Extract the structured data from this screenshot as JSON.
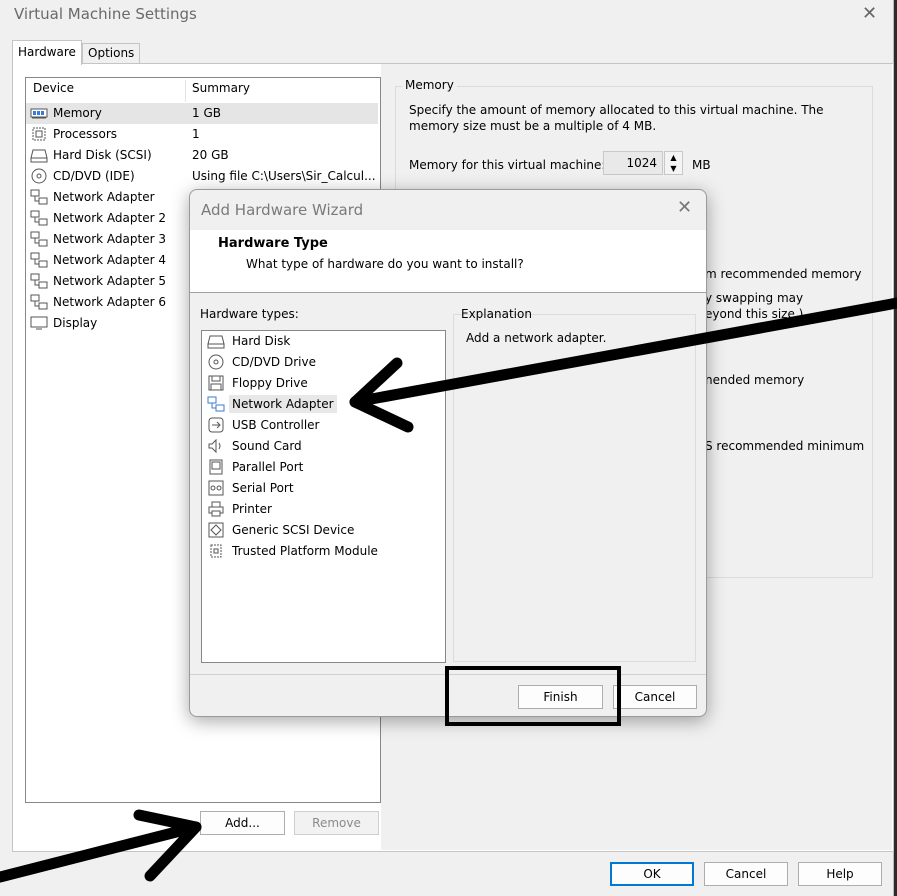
{
  "window": {
    "title": "Virtual Machine Settings",
    "close_glyph": "✕",
    "tabs": [
      "Hardware",
      "Options"
    ]
  },
  "device_list": {
    "columns": [
      "Device",
      "Summary"
    ],
    "rows": [
      {
        "icon": "memory-icon",
        "name": "Memory",
        "summary": "1 GB"
      },
      {
        "icon": "processor-icon",
        "name": "Processors",
        "summary": "1"
      },
      {
        "icon": "hard-disk-icon",
        "name": "Hard Disk (SCSI)",
        "summary": "20 GB"
      },
      {
        "icon": "cd-dvd-icon",
        "name": "CD/DVD (IDE)",
        "summary": "Using file C:\\Users\\Sir_Calcul..."
      },
      {
        "icon": "network-adapter-icon",
        "name": "Network Adapter",
        "summary": ""
      },
      {
        "icon": "network-adapter-icon",
        "name": "Network Adapter 2",
        "summary": ""
      },
      {
        "icon": "network-adapter-icon",
        "name": "Network Adapter 3",
        "summary": ""
      },
      {
        "icon": "network-adapter-icon",
        "name": "Network Adapter 4",
        "summary": ""
      },
      {
        "icon": "network-adapter-icon",
        "name": "Network Adapter 5",
        "summary": ""
      },
      {
        "icon": "network-adapter-icon",
        "name": "Network Adapter 6",
        "summary": ""
      },
      {
        "icon": "display-icon",
        "name": "Display",
        "summary": ""
      }
    ]
  },
  "memory": {
    "group_title": "Memory",
    "description": "Specify the amount of memory allocated to this virtual machine. The memory size must be a multiple of 4 MB.",
    "field_label": "Memory for this virtual machine:",
    "value": "1024",
    "unit": "MB",
    "partial_lines": [
      "m recommended memory",
      "y swapping may",
      "eyond this size.)",
      "nended memory",
      "S recommended minimum"
    ]
  },
  "buttons": {
    "add": "Add...",
    "remove": "Remove",
    "ok": "OK",
    "cancel": "Cancel",
    "help": "Help"
  },
  "wizard": {
    "title": "Add Hardware Wizard",
    "close_glyph": "✕",
    "header_title": "Hardware Type",
    "header_subtitle": "What type of hardware do you want to install?",
    "types_label": "Hardware types:",
    "types": [
      {
        "icon": "hard-disk-icon",
        "name": "Hard Disk"
      },
      {
        "icon": "cd-dvd-icon",
        "name": "CD/DVD Drive"
      },
      {
        "icon": "floppy-icon",
        "name": "Floppy Drive"
      },
      {
        "icon": "network-adapter-icon",
        "name": "Network Adapter"
      },
      {
        "icon": "usb-icon",
        "name": "USB Controller"
      },
      {
        "icon": "sound-icon",
        "name": "Sound Card"
      },
      {
        "icon": "parallel-port-icon",
        "name": "Parallel Port"
      },
      {
        "icon": "serial-port-icon",
        "name": "Serial Port"
      },
      {
        "icon": "printer-icon",
        "name": "Printer"
      },
      {
        "icon": "scsi-icon",
        "name": "Generic SCSI Device"
      },
      {
        "icon": "tpm-icon",
        "name": "Trusted Platform Module"
      }
    ],
    "selected_type": "Network Adapter",
    "explanation_label": "Explanation",
    "explanation_text": "Add a network adapter.",
    "finish": "Finish",
    "cancel": "Cancel"
  },
  "annotation_color": "#000000"
}
